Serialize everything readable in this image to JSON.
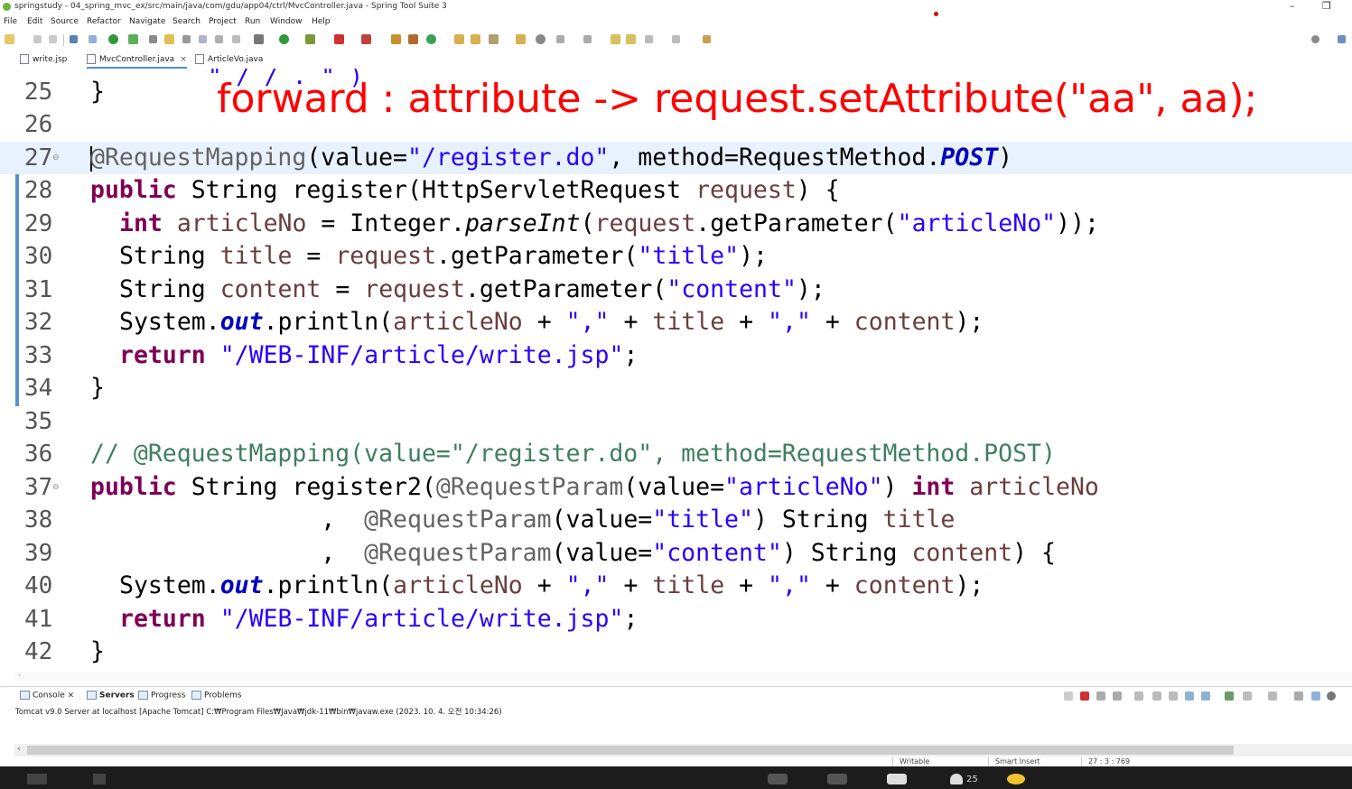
{
  "window": {
    "title": "springstudy - 04_spring_mvc_ex/src/main/java/com/gdu/app04/ctrl/MvcController.java - Spring Tool Suite 3",
    "minimize_label": "–",
    "restore_label": "❐"
  },
  "menu": [
    "File",
    "Edit",
    "Source",
    "Refactor",
    "Navigate",
    "Search",
    "Project",
    "Run",
    "Window",
    "Help"
  ],
  "editor_tabs": [
    {
      "label": "write.jsp"
    },
    {
      "label": "MvcController.java",
      "close": "×"
    },
    {
      "label": "ArticleVo.java"
    }
  ],
  "overlay_annotation": "forward : attribute -> request.setAttribute(\"aa\", aa);",
  "top_cut_text": "\"  /       /    .  \"  )",
  "code": {
    "lines": [
      {
        "n": "25"
      },
      {
        "n": "26"
      },
      {
        "n": "27",
        "fold": "⊖"
      },
      {
        "n": "28"
      },
      {
        "n": "29"
      },
      {
        "n": "30"
      },
      {
        "n": "31"
      },
      {
        "n": "32"
      },
      {
        "n": "33"
      },
      {
        "n": "34"
      },
      {
        "n": "35"
      },
      {
        "n": "36"
      },
      {
        "n": "37",
        "fold": "⊖"
      },
      {
        "n": "38"
      },
      {
        "n": "39"
      },
      {
        "n": "40"
      },
      {
        "n": "41"
      },
      {
        "n": "42"
      }
    ],
    "t": {
      "brace": "}",
      "at_req": "@RequestMapping",
      "l27_a": "(value=",
      "l27_s": "\"/register.do\"",
      "l27_b": ", method=RequestMethod.",
      "l27_e": "POST",
      "l27_c": ")",
      "public": "public",
      "l28_a": " String register(HttpServletRequest ",
      "request": "request",
      "l28_b": ") {",
      "int": "int",
      "sp": " ",
      "articleNo": "articleNo",
      "l29_a": " = Integer.",
      "parseInt": "parseInt",
      "lp": "(",
      "l29_b": ".getParameter(",
      "s_articleNo": "\"articleNo\"",
      "l29_c": "));",
      "String": "String ",
      "title": "title",
      "eq": " = ",
      "s_title": "\"title\"",
      "end_paren": ");",
      "content": "content",
      "s_content": "\"content\"",
      "System": "System.",
      "out": "out",
      "println": ".println(",
      "plus": " + ",
      "s_comma": "\",\"",
      "return": "return",
      "s_path": "\"/WEB-INF/article/write.jsp\"",
      "semi": ";",
      "l36": "// @RequestMapping(value=\"/register.do\", method=RequestMethod.POST)",
      "l37_a": " String register2(",
      "at_param": "@RequestParam",
      "value_eq": "(value=",
      "rp": ") ",
      "indent38": "                ,  ",
      "l39_end": ") {"
    }
  },
  "console": {
    "tabs": [
      {
        "label": "Console",
        "close": "×"
      },
      {
        "label": "Servers"
      },
      {
        "label": "Progress"
      },
      {
        "label": "Problems"
      }
    ],
    "info": "Tomcat v9.0 Server at localhost [Apache Tomcat] C:₩Program Files₩Java₩jdk-11₩bin₩javaw.exe  (2023. 10. 4. 오전 10:34:26)"
  },
  "status": {
    "writable": "Writable",
    "insert_mode": "Smart Insert",
    "position": "27 : 3 : 769"
  },
  "taskbar": {
    "participants": "25"
  },
  "colors": {
    "keyword": "#7f0055",
    "string": "#2a00ff",
    "annotation": "#646464",
    "comment": "#3f7f5f",
    "overlay": "#ff0000",
    "current_line": "#e8f2fe"
  }
}
